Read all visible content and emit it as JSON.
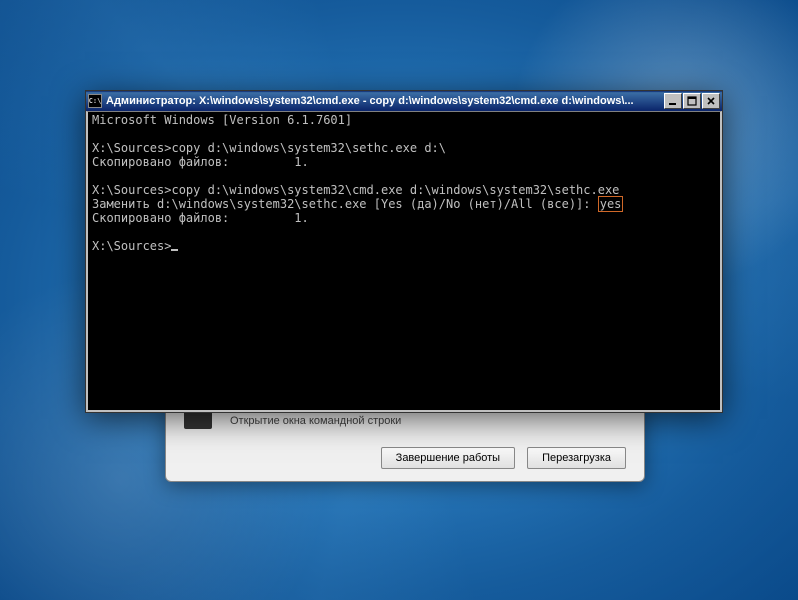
{
  "background_dialog": {
    "caption": "Открытие окна командной строки",
    "buttons": {
      "shutdown": "Завершение работы",
      "restart": "Перезагрузка"
    }
  },
  "cmd_window": {
    "title": "Администратор: X:\\windows\\system32\\cmd.exe - copy  d:\\windows\\system32\\cmd.exe d:\\windows\\...",
    "lines": {
      "l1": "Microsoft Windows [Version 6.1.7601]",
      "l2": "",
      "l3": "X:\\Sources>copy d:\\windows\\system32\\sethc.exe d:\\",
      "l4": "Скопировано файлов:         1.",
      "l5": "",
      "l6": "X:\\Sources>copy d:\\windows\\system32\\cmd.exe d:\\windows\\system32\\sethc.exe",
      "l7a": "Заменить d:\\windows\\system32\\sethc.exe [Yes (да)/No (нет)/All (все)]: ",
      "l7b": "yes",
      "l8": "Скопировано файлов:         1.",
      "l9": "",
      "l10": "X:\\Sources>"
    }
  }
}
